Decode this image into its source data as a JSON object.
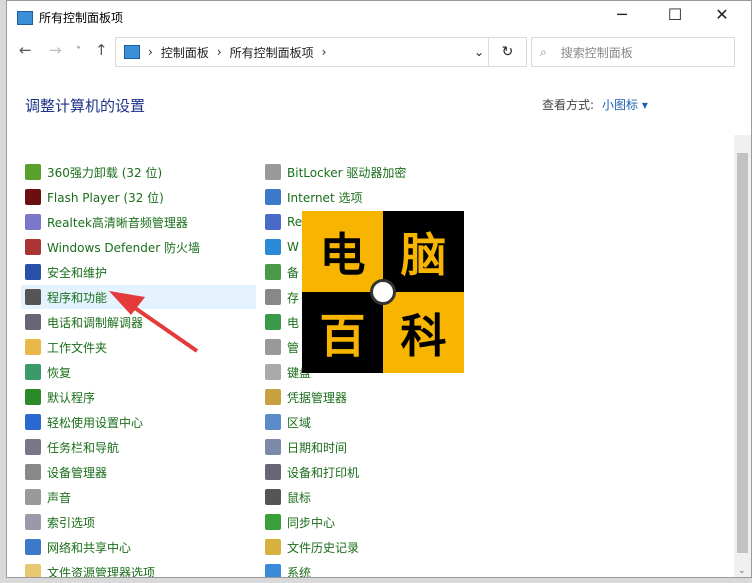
{
  "window": {
    "title": "所有控制面板项",
    "minimize": "─",
    "maximize": "☐",
    "close": "✕"
  },
  "nav": {
    "back": "←",
    "forward": "→",
    "recent": "˅",
    "up": "↑"
  },
  "address": {
    "crumbs": [
      "控制面板",
      "所有控制面板项"
    ],
    "sep": "›",
    "dropdown": "⌄",
    "refresh": "↻"
  },
  "search": {
    "placeholder": "搜索控制面板",
    "icon": "⌕"
  },
  "heading": "调整计算机的设置",
  "view": {
    "label": "查看方式:",
    "value": "小图标 ▾"
  },
  "left_items": [
    {
      "label": "360强力卸载 (32 位)",
      "color": "#5aa02c"
    },
    {
      "label": "Flash Player (32 位)",
      "color": "#6b0f0f"
    },
    {
      "label": "Realtek高清晰音频管理器",
      "color": "#7a76c8"
    },
    {
      "label": "Windows Defender 防火墙",
      "color": "#a33"
    },
    {
      "label": "安全和维护",
      "color": "#2a4fa8"
    },
    {
      "label": "程序和功能",
      "color": "#555"
    },
    {
      "label": "电话和调制解调器",
      "color": "#667"
    },
    {
      "label": "工作文件夹",
      "color": "#e8b84a"
    },
    {
      "label": "恢复",
      "color": "#3a9a6a"
    },
    {
      "label": "默认程序",
      "color": "#2a8a2a"
    },
    {
      "label": "轻松使用设置中心",
      "color": "#2a6ad0"
    },
    {
      "label": "任务栏和导航",
      "color": "#778"
    },
    {
      "label": "设备管理器",
      "color": "#888"
    },
    {
      "label": "声音",
      "color": "#999"
    },
    {
      "label": "索引选项",
      "color": "#99a"
    },
    {
      "label": "网络和共享中心",
      "color": "#3a7ac8"
    },
    {
      "label": "文件资源管理器选项",
      "color": "#e8c870"
    }
  ],
  "right_items": [
    {
      "label": "BitLocker 驱动器加密",
      "color": "#999"
    },
    {
      "label": "Internet 选项",
      "color": "#3a7ac8"
    },
    {
      "label": "Re",
      "color": "#4a6ac8"
    },
    {
      "label": "W",
      "color": "#2a8ad8"
    },
    {
      "label": "备",
      "color": "#4a9a4a"
    },
    {
      "label": "存",
      "color": "#888"
    },
    {
      "label": "电",
      "color": "#3a9a4a"
    },
    {
      "label": "管",
      "color": "#999"
    },
    {
      "label": "键盘",
      "color": "#aaa"
    },
    {
      "label": "凭据管理器",
      "color": "#c8a040"
    },
    {
      "label": "区域",
      "color": "#5a8ac8"
    },
    {
      "label": "日期和时间",
      "color": "#7a8aa8"
    },
    {
      "label": "设备和打印机",
      "color": "#667"
    },
    {
      "label": "鼠标",
      "color": "#555"
    },
    {
      "label": "同步中心",
      "color": "#3aa03a"
    },
    {
      "label": "文件历史记录",
      "color": "#d8b040"
    },
    {
      "label": "系统",
      "color": "#3a8ad8"
    }
  ],
  "logo": {
    "chars": [
      "电",
      "脑",
      "百",
      "科"
    ],
    "seal": "电脑百科"
  }
}
